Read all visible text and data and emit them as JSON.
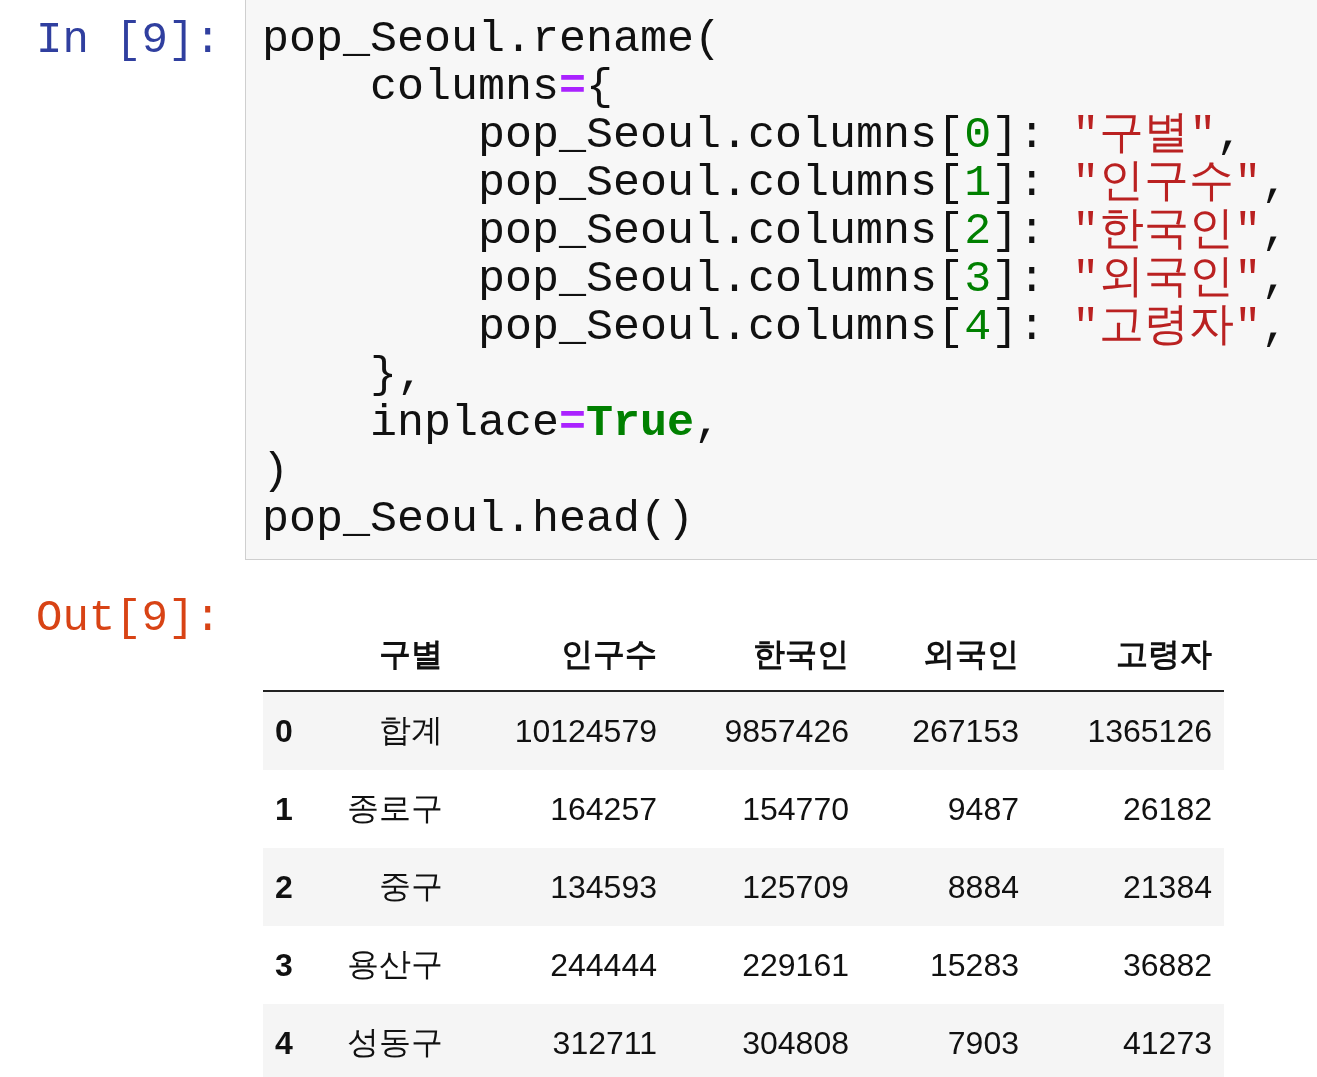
{
  "input": {
    "prompt": "In [9]:",
    "lines": [
      [
        {
          "kind": "name",
          "text": "pop_Seoul.rename("
        }
      ],
      [
        {
          "kind": "name",
          "text": "    columns"
        },
        {
          "kind": "op",
          "text": "="
        },
        {
          "kind": "name",
          "text": "{"
        }
      ],
      [
        {
          "kind": "name",
          "text": "        pop_Seoul.columns["
        },
        {
          "kind": "number",
          "text": "0"
        },
        {
          "kind": "name",
          "text": "]: "
        },
        {
          "kind": "string",
          "text": "\"구별\""
        },
        {
          "kind": "name",
          "text": ","
        }
      ],
      [
        {
          "kind": "name",
          "text": "        pop_Seoul.columns["
        },
        {
          "kind": "number",
          "text": "1"
        },
        {
          "kind": "name",
          "text": "]: "
        },
        {
          "kind": "string",
          "text": "\"인구수\""
        },
        {
          "kind": "name",
          "text": ","
        }
      ],
      [
        {
          "kind": "name",
          "text": "        pop_Seoul.columns["
        },
        {
          "kind": "number",
          "text": "2"
        },
        {
          "kind": "name",
          "text": "]: "
        },
        {
          "kind": "string",
          "text": "\"한국인\""
        },
        {
          "kind": "name",
          "text": ","
        }
      ],
      [
        {
          "kind": "name",
          "text": "        pop_Seoul.columns["
        },
        {
          "kind": "number",
          "text": "3"
        },
        {
          "kind": "name",
          "text": "]: "
        },
        {
          "kind": "string",
          "text": "\"외국인\""
        },
        {
          "kind": "name",
          "text": ","
        }
      ],
      [
        {
          "kind": "name",
          "text": "        pop_Seoul.columns["
        },
        {
          "kind": "number",
          "text": "4"
        },
        {
          "kind": "name",
          "text": "]: "
        },
        {
          "kind": "string",
          "text": "\"고령자\""
        },
        {
          "kind": "name",
          "text": ","
        }
      ],
      [
        {
          "kind": "name",
          "text": "    },"
        }
      ],
      [
        {
          "kind": "name",
          "text": "    inplace"
        },
        {
          "kind": "op",
          "text": "="
        },
        {
          "kind": "keyword",
          "text": "True"
        },
        {
          "kind": "name",
          "text": ","
        }
      ],
      [
        {
          "kind": "name",
          "text": ")"
        }
      ],
      [
        {
          "kind": "name",
          "text": "pop_Seoul.head()"
        }
      ]
    ]
  },
  "output": {
    "prompt": "Out[9]:",
    "table": {
      "columns": [
        "구별",
        "인구수",
        "한국인",
        "외국인",
        "고령자"
      ],
      "rows": [
        {
          "index": "0",
          "cells": [
            "합계",
            "10124579",
            "9857426",
            "267153",
            "1365126"
          ]
        },
        {
          "index": "1",
          "cells": [
            "종로구",
            "164257",
            "154770",
            "9487",
            "26182"
          ]
        },
        {
          "index": "2",
          "cells": [
            "중구",
            "134593",
            "125709",
            "8884",
            "21384"
          ]
        },
        {
          "index": "3",
          "cells": [
            "용산구",
            "244444",
            "229161",
            "15283",
            "36882"
          ]
        },
        {
          "index": "4",
          "cells": [
            "성동구",
            "312711",
            "304808",
            "7903",
            "41273"
          ]
        }
      ]
    }
  }
}
